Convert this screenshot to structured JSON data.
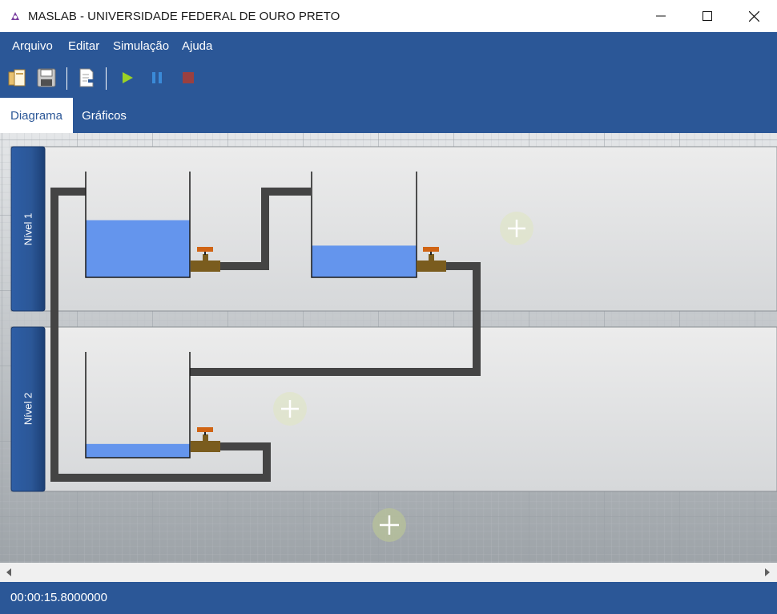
{
  "window": {
    "title": "MASLAB - UNIVERSIDADE FEDERAL DE OURO PRETO",
    "icon": "maslab-logo-icon"
  },
  "menu": {
    "items": [
      {
        "label": "Arquivo"
      },
      {
        "label": "Editar"
      },
      {
        "label": "Simulação"
      },
      {
        "label": "Ajuda"
      }
    ]
  },
  "toolbar": {
    "icons": [
      "open-icon",
      "save-icon",
      "export-icon",
      "play-icon",
      "pause-icon",
      "stop-icon"
    ]
  },
  "tabs": [
    {
      "label": "Diagrama",
      "active": true
    },
    {
      "label": "Gráficos",
      "active": false
    }
  ],
  "diagram": {
    "levels": [
      {
        "label": "Nível 1"
      },
      {
        "label": "Nível 2"
      }
    ],
    "tanks": [
      {
        "name": "tank-1",
        "fill_fraction": 0.54
      },
      {
        "name": "tank-2",
        "fill_fraction": 0.3
      },
      {
        "name": "tank-3",
        "fill_fraction": 0.13
      }
    ]
  },
  "status": {
    "time": "00:00:15.8000000"
  },
  "colors": {
    "brand": "#2b5797",
    "water": "#6495ed",
    "pipe": "#444444",
    "valve_body": "#7a5c1e",
    "valve_handle": "#d06414"
  }
}
